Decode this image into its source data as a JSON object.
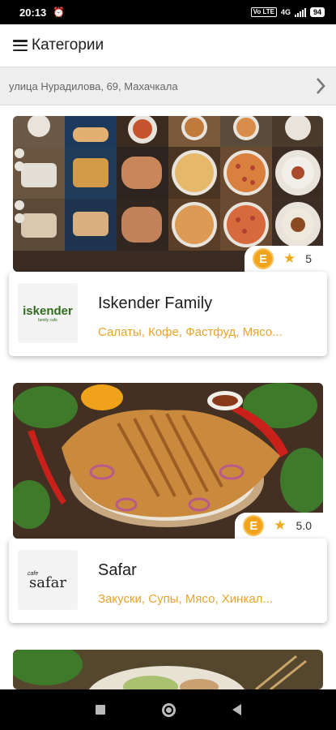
{
  "status_bar": {
    "time": "20:13",
    "network": "4G",
    "volte": "Vo LTE",
    "battery": "94"
  },
  "app_bar": {
    "title": "Категории"
  },
  "address": {
    "text": "улица Нурадилова, 69, Махачкала"
  },
  "restaurants": [
    {
      "name": "Iskender Family",
      "categories": "Салаты, Кофе, Фастфуд, Мясо...",
      "rating": "5",
      "logo_text": "iskender",
      "logo_subtext": "family cafe"
    },
    {
      "name": "Safar",
      "categories": "Закуски, Супы, Мясо, Хинкал...",
      "rating": "5.0",
      "logo_text": "safar",
      "logo_subtext": "cafe"
    }
  ],
  "colors": {
    "accent": "#e8a32c",
    "coin": "#f2a31b",
    "star": "#f0a81c",
    "iskender_logo": "#2e6b1d"
  }
}
